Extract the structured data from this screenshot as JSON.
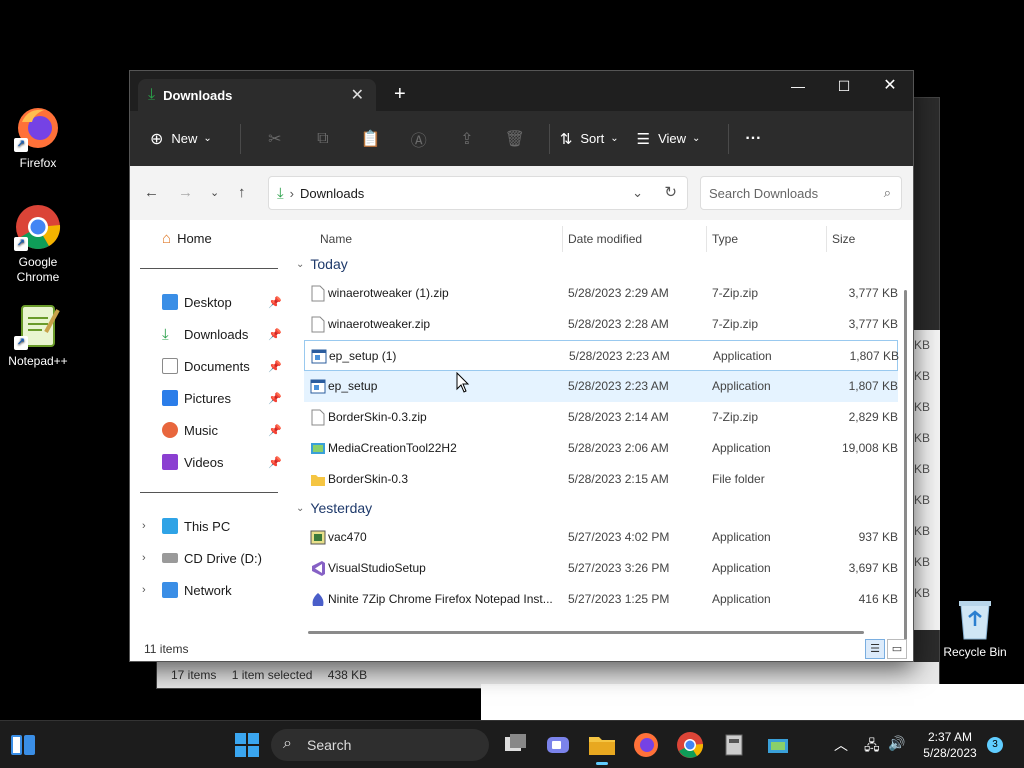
{
  "desktop": {
    "icons": [
      {
        "label": "Firefox",
        "icon": "firefox-icon"
      },
      {
        "label": "Google Chrome",
        "icon": "chrome-icon"
      },
      {
        "label": "Notepad++",
        "icon": "notepadpp-icon"
      },
      {
        "label": "Recycle Bin",
        "icon": "recycle-bin-icon"
      }
    ]
  },
  "background_window": {
    "status_items": "17 items",
    "status_selected": "1 item selected",
    "status_size": "438 KB",
    "right_col": [
      "KB",
      "KB",
      "KB",
      "KB",
      "KB",
      "KB",
      "KB",
      "KB",
      "KB",
      "KB"
    ]
  },
  "window": {
    "tab_title": "Downloads",
    "tab_close": "✕",
    "new_tab": "+",
    "minimize": "—",
    "maximize": "☐",
    "close": "✕"
  },
  "toolbar": {
    "new_label": "New",
    "sort_label": "Sort",
    "view_label": "View",
    "more_label": "···"
  },
  "address": {
    "location": "Downloads",
    "search_placeholder": "Search Downloads"
  },
  "sidebar": {
    "home": "Home",
    "pinned": [
      {
        "label": "Desktop",
        "icon": "desktop-icon",
        "color": "#3a8ee6"
      },
      {
        "label": "Downloads",
        "icon": "downloads-icon",
        "color": "#2aa14a"
      },
      {
        "label": "Documents",
        "icon": "documents-icon",
        "color": "#8a8a8a"
      },
      {
        "label": "Pictures",
        "icon": "pictures-icon",
        "color": "#2b7de9"
      },
      {
        "label": "Music",
        "icon": "music-icon",
        "color": "#e8663d"
      },
      {
        "label": "Videos",
        "icon": "videos-icon",
        "color": "#8b3fd1"
      }
    ],
    "drives": [
      {
        "label": "This PC",
        "icon": "this-pc-icon"
      },
      {
        "label": "CD Drive (D:)",
        "icon": "cd-drive-icon"
      },
      {
        "label": "Network",
        "icon": "network-icon"
      }
    ]
  },
  "columns": {
    "name": "Name",
    "date": "Date modified",
    "type": "Type",
    "size": "Size"
  },
  "groups": {
    "today": "Today",
    "yesterday": "Yesterday"
  },
  "files_today": [
    {
      "name": "winaerotweaker (1).zip",
      "date": "5/28/2023 2:29 AM",
      "type": "7-Zip.zip",
      "size": "3,777 KB",
      "icon": "zip-file-icon"
    },
    {
      "name": "winaerotweaker.zip",
      "date": "5/28/2023 2:28 AM",
      "type": "7-Zip.zip",
      "size": "3,777 KB",
      "icon": "zip-file-icon"
    },
    {
      "name": "ep_setup (1)",
      "date": "5/28/2023 2:23 AM",
      "type": "Application",
      "size": "1,807 KB",
      "icon": "application-icon"
    },
    {
      "name": "ep_setup",
      "date": "5/28/2023 2:23 AM",
      "type": "Application",
      "size": "1,807 KB",
      "icon": "application-icon"
    },
    {
      "name": "BorderSkin-0.3.zip",
      "date": "5/28/2023 2:14 AM",
      "type": "7-Zip.zip",
      "size": "2,829 KB",
      "icon": "zip-file-icon"
    },
    {
      "name": "MediaCreationTool22H2",
      "date": "5/28/2023 2:06 AM",
      "type": "Application",
      "size": "19,008 KB",
      "icon": "media-creation-icon"
    },
    {
      "name": "BorderSkin-0.3",
      "date": "5/28/2023 2:15 AM",
      "type": "File folder",
      "size": "",
      "icon": "folder-icon"
    }
  ],
  "files_yesterday": [
    {
      "name": "vac470",
      "date": "5/27/2023 4:02 PM",
      "type": "Application",
      "size": "937 KB",
      "icon": "installer-icon"
    },
    {
      "name": "VisualStudioSetup",
      "date": "5/27/2023 3:26 PM",
      "type": "Application",
      "size": "3,697 KB",
      "icon": "visual-studio-icon"
    },
    {
      "name": "Ninite 7Zip Chrome Firefox Notepad Inst...",
      "date": "5/27/2023 1:25 PM",
      "type": "Application",
      "size": "416 KB",
      "icon": "ninite-icon"
    }
  ],
  "status": {
    "count": "11 items"
  },
  "taskbar": {
    "search_label": "Search",
    "time": "2:37 AM",
    "date": "5/28/2023",
    "notifications": "3"
  }
}
